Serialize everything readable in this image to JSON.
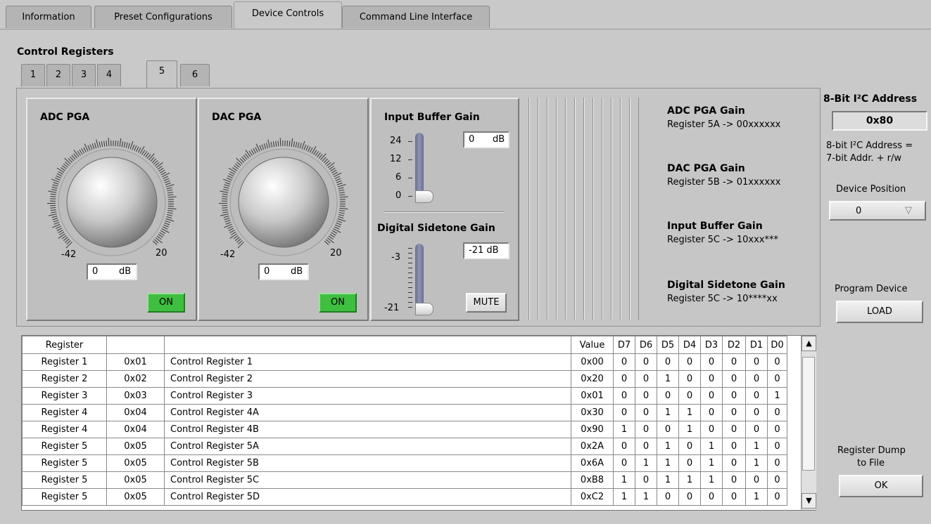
{
  "top_tabs": [
    "Information",
    "Preset Configurations",
    "Device Controls",
    "Command Line Interface"
  ],
  "active_top_tab": "Device Controls",
  "control_registers": {
    "title": "Control Registers",
    "tabs": [
      "1",
      "2",
      "3",
      "4",
      "5",
      "6"
    ],
    "active_tab": "5"
  },
  "adc_pga": {
    "title": "ADC PGA",
    "min_label": "-42",
    "max_label": "20",
    "value": "0",
    "unit": "dB",
    "button": "ON"
  },
  "dac_pga": {
    "title": "DAC PGA",
    "min_label": "-42",
    "max_label": "20",
    "value": "0",
    "unit": "dB",
    "button": "ON"
  },
  "input_buffer": {
    "title": "Input Buffer Gain",
    "ticks": [
      "24",
      "12",
      "6",
      "0"
    ],
    "value": "0",
    "unit": "dB"
  },
  "sidetone": {
    "title": "Digital Sidetone Gain",
    "ticks": [
      "-3",
      "-21"
    ],
    "value": "-21 dB",
    "button": "MUTE"
  },
  "info": [
    {
      "title": "ADC PGA Gain",
      "sub": "Register 5A -> 00xxxxxx"
    },
    {
      "title": "DAC PGA Gain",
      "sub": "Register 5B -> 01xxxxxx"
    },
    {
      "title": "Input Buffer Gain",
      "sub": "Register 5C -> 10xxx***"
    },
    {
      "title": "Digital Sidetone Gain",
      "sub": "Register 5C -> 10****xx"
    }
  ],
  "right": {
    "address_title": "8-Bit I²C Address",
    "address_value": "0x80",
    "address_note_1": "8-bit I²C Address =",
    "address_note_2": "7-bit Addr. + r/w",
    "position_label": "Device Position",
    "position_value": "0",
    "program_label": "Program Device",
    "load_button": "LOAD",
    "dump_label_1": "Register Dump",
    "dump_label_2": "to File",
    "ok_button": "OK"
  },
  "table": {
    "headers": {
      "register": "Register",
      "value": "Value",
      "bits": [
        "D7",
        "D6",
        "D5",
        "D4",
        "D3",
        "D2",
        "D1",
        "D0"
      ]
    },
    "rows": [
      {
        "register": "Register 1",
        "addr": "0x01",
        "name": "Control Register 1",
        "value": "0x00",
        "bits": [
          "0",
          "0",
          "0",
          "0",
          "0",
          "0",
          "0",
          "0"
        ]
      },
      {
        "register": "Register 2",
        "addr": "0x02",
        "name": "Control Register 2",
        "value": "0x20",
        "bits": [
          "0",
          "0",
          "1",
          "0",
          "0",
          "0",
          "0",
          "0"
        ]
      },
      {
        "register": "Register 3",
        "addr": "0x03",
        "name": "Control Register 3",
        "value": "0x01",
        "bits": [
          "0",
          "0",
          "0",
          "0",
          "0",
          "0",
          "0",
          "1"
        ]
      },
      {
        "register": "Register 4",
        "addr": "0x04",
        "name": "Control Register 4A",
        "value": "0x30",
        "bits": [
          "0",
          "0",
          "1",
          "1",
          "0",
          "0",
          "0",
          "0"
        ]
      },
      {
        "register": "Register 4",
        "addr": "0x04",
        "name": "Control Register 4B",
        "value": "0x90",
        "bits": [
          "1",
          "0",
          "0",
          "1",
          "0",
          "0",
          "0",
          "0"
        ]
      },
      {
        "register": "Register 5",
        "addr": "0x05",
        "name": "Control Register 5A",
        "value": "0x2A",
        "bits": [
          "0",
          "0",
          "1",
          "0",
          "1",
          "0",
          "1",
          "0"
        ]
      },
      {
        "register": "Register 5",
        "addr": "0x05",
        "name": "Control Register 5B",
        "value": "0x6A",
        "bits": [
          "0",
          "1",
          "1",
          "0",
          "1",
          "0",
          "1",
          "0"
        ]
      },
      {
        "register": "Register 5",
        "addr": "0x05",
        "name": "Control Register 5C",
        "value": "0xB8",
        "bits": [
          "1",
          "0",
          "1",
          "1",
          "1",
          "0",
          "0",
          "0"
        ]
      },
      {
        "register": "Register 5",
        "addr": "0x05",
        "name": "Control Register 5D",
        "value": "0xC2",
        "bits": [
          "1",
          "1",
          "0",
          "0",
          "0",
          "0",
          "1",
          "0"
        ]
      }
    ]
  },
  "colors": {
    "on_button": "#3fbf3f",
    "background": "#c9c9c9",
    "slider": "#7d82a3"
  }
}
